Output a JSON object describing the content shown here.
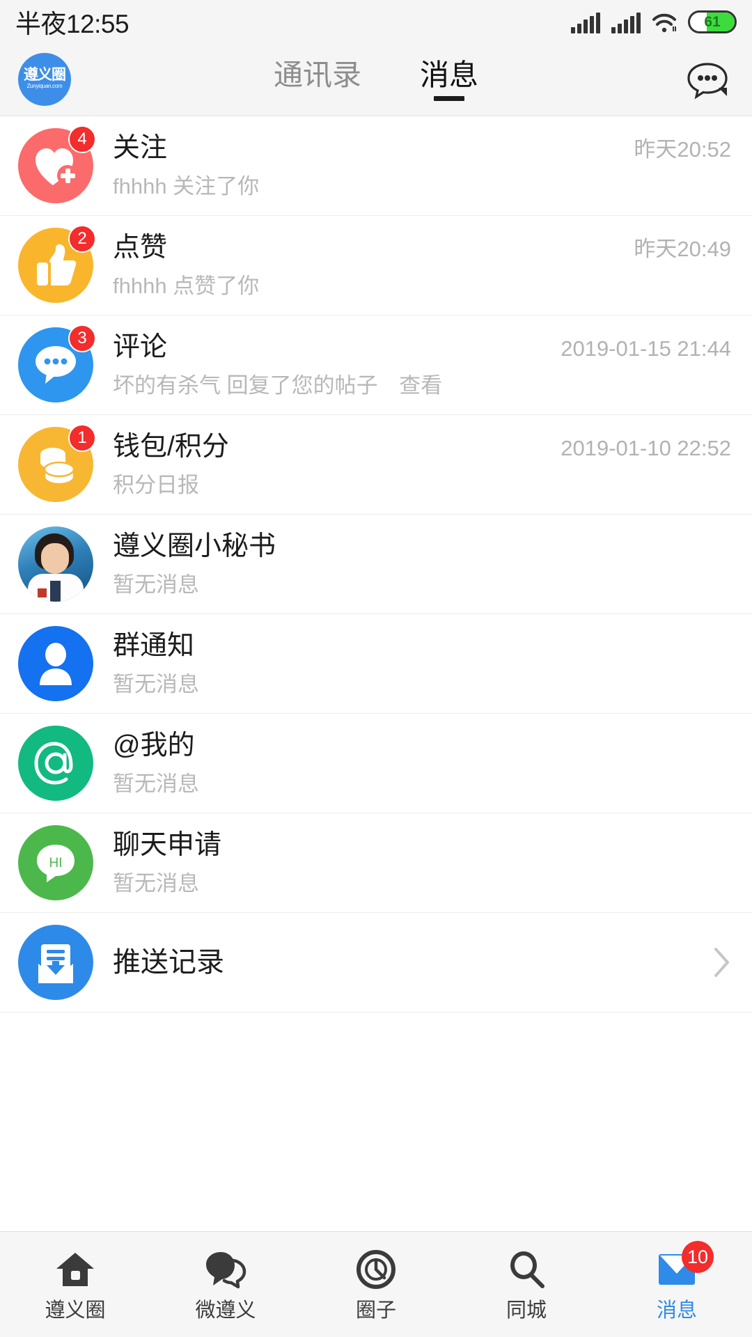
{
  "status_bar": {
    "time": "半夜12:55",
    "battery_percent": "61",
    "icons": [
      "signal-icon",
      "signal-icon",
      "wifi-icon",
      "battery-icon"
    ]
  },
  "header": {
    "logo_cn": "遵义圈",
    "logo_en": "Zunyiquan.com",
    "tabs": [
      {
        "label": "通讯录",
        "active": false
      },
      {
        "label": "消息",
        "active": true
      }
    ],
    "more_icon": "chat-more-icon"
  },
  "message_list": [
    {
      "icon": "heart-plus-icon",
      "icon_color": "#fb6b6b",
      "title": "关注",
      "subtitle": "fhhhh 关注了你",
      "time": "昨天20:52",
      "badge": "4"
    },
    {
      "icon": "thumbs-up-icon",
      "icon_color": "#f9b62c",
      "title": "点赞",
      "subtitle": "fhhhh 点赞了你",
      "time": "昨天20:49",
      "badge": "2"
    },
    {
      "icon": "comment-bubble-icon",
      "icon_color": "#2e96ef",
      "title": "评论",
      "subtitle": "坏的有杀气 回复了您的帖子",
      "subtitle_link": "查看",
      "time": "2019-01-15 21:44",
      "badge": "3"
    },
    {
      "icon": "coins-icon",
      "icon_color": "#f7b733",
      "title": "钱包/积分",
      "subtitle": "积分日报",
      "time": "2019-01-10 22:52",
      "badge": "1"
    },
    {
      "icon": "customer-service-avatar",
      "icon_color": "#2f7fb8",
      "title": "遵义圈小秘书",
      "subtitle": "暂无消息",
      "time": "",
      "badge": ""
    },
    {
      "icon": "group-person-icon",
      "icon_color": "#1471f0",
      "title": "群通知",
      "subtitle": "暂无消息",
      "time": "",
      "badge": ""
    },
    {
      "icon": "at-sign-icon",
      "icon_color": "#12b981",
      "title": "@我的",
      "subtitle": "暂无消息",
      "time": "",
      "badge": ""
    },
    {
      "icon": "hi-bubble-icon",
      "icon_color": "#4cb84c",
      "title": "聊天申请",
      "subtitle": "暂无消息",
      "time": "",
      "badge": ""
    }
  ],
  "push_record": {
    "icon": "inbox-mail-icon",
    "icon_color": "#2e8ae8",
    "title": "推送记录",
    "chevron": "chevron-right-icon"
  },
  "bottom_nav": [
    {
      "icon": "home-icon",
      "label": "遵义圈",
      "active": false,
      "badge": ""
    },
    {
      "icon": "chat-bubble-icon",
      "label": "微遵义",
      "active": false,
      "badge": ""
    },
    {
      "icon": "compass-icon",
      "label": "圈子",
      "active": false,
      "badge": ""
    },
    {
      "icon": "search-icon",
      "label": "同城",
      "active": false,
      "badge": ""
    },
    {
      "icon": "message-envelope-icon",
      "label": "消息",
      "active": true,
      "badge": "10"
    }
  ],
  "colors": {
    "accent": "#2f8ae8",
    "badge_red": "#f32c2c",
    "page_bg": "#f5f5f5",
    "row_bg": "#ffffff"
  }
}
